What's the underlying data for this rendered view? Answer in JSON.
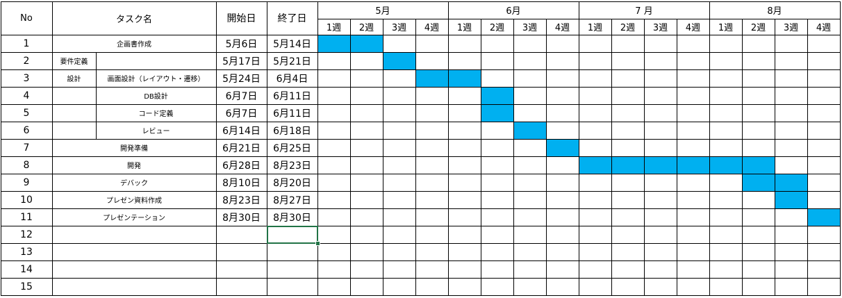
{
  "header": {
    "no": "No",
    "task": "タスク名",
    "start": "開始日",
    "end": "終了日"
  },
  "months": [
    "5月",
    "6月",
    "7 月",
    "8月"
  ],
  "weeks": [
    "1週",
    "2週",
    "3週",
    "4週",
    "1週",
    "2週",
    "3週",
    "4週",
    "1週",
    "2週",
    "3週",
    "4週",
    "1週",
    "2週",
    "3週",
    "4週"
  ],
  "tasks": [
    {
      "no": "1",
      "name": "企画書作成",
      "start": "5月6日",
      "end": "5月14日",
      "bar": [
        0,
        1
      ]
    },
    {
      "no": "2",
      "group": "要件定義",
      "name": "",
      "start": "5月17日",
      "end": "5月21日",
      "bar": [
        2
      ]
    },
    {
      "no": "3",
      "group": "設計",
      "name": "画面設計（レイアウト・遷移）",
      "start": "5月24日",
      "end": "6月4日",
      "bar": [
        3,
        4
      ]
    },
    {
      "no": "4",
      "name": "DB設計",
      "start": "6月7日",
      "end": "6月11日",
      "bar": [
        5
      ]
    },
    {
      "no": "5",
      "name": "コード定義",
      "start": "6月7日",
      "end": "6月11日",
      "bar": [
        5
      ]
    },
    {
      "no": "6",
      "name": "レビュー",
      "start": "6月14日",
      "end": "6月18日",
      "bar": [
        6
      ]
    },
    {
      "no": "7",
      "name": "開発準備",
      "start": "6月21日",
      "end": "6月25日",
      "bar": [
        7
      ]
    },
    {
      "no": "8",
      "name": "開発",
      "start": "6月28日",
      "end": "8月23日",
      "bar": [
        8,
        9,
        10,
        11,
        12,
        13
      ]
    },
    {
      "no": "9",
      "name": "デバック",
      "start": "8月10日",
      "end": "8月20日",
      "bar": [
        13,
        14
      ]
    },
    {
      "no": "10",
      "name": "プレゼン資料作成",
      "start": "8月23日",
      "end": "8月27日",
      "bar": [
        14
      ]
    },
    {
      "no": "11",
      "name": "プレゼンテーション",
      "start": "8月30日",
      "end": "8月30日",
      "bar": [
        15
      ]
    },
    {
      "no": "12",
      "name": "",
      "start": "",
      "end": "",
      "bar": []
    },
    {
      "no": "13",
      "name": "",
      "start": "",
      "end": "",
      "bar": []
    },
    {
      "no": "14",
      "name": "",
      "start": "",
      "end": "",
      "bar": []
    },
    {
      "no": "15",
      "name": "",
      "start": "",
      "end": "",
      "bar": []
    }
  ],
  "colors": {
    "bar": "#00b0f0",
    "selection": "#217346",
    "grid": "#000000"
  },
  "selected_cell": {
    "row": 12,
    "column": "end"
  }
}
